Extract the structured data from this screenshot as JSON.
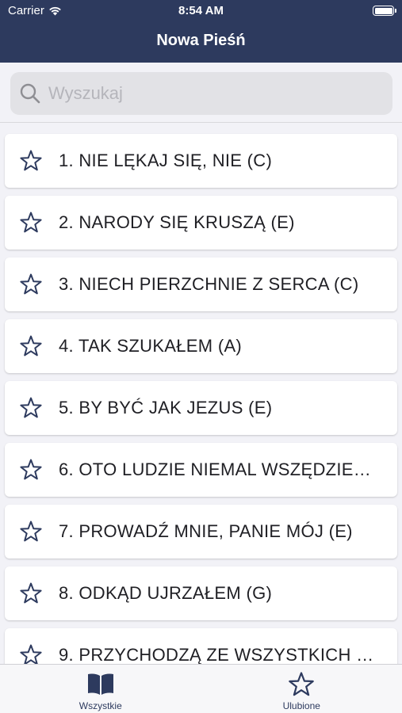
{
  "status_bar": {
    "carrier": "Carrier",
    "time": "8:54 AM"
  },
  "nav": {
    "title": "Nowa Pieśń"
  },
  "search": {
    "placeholder": "Wyszukaj"
  },
  "songs": [
    {
      "title": "1. NIE LĘKAJ SIĘ, NIE (C)"
    },
    {
      "title": "2. NARODY SIĘ KRUSZĄ (E)"
    },
    {
      "title": "3. NIECH PIERZCHNIE Z SERCA (C)"
    },
    {
      "title": "4. TAK SZUKAŁEM (A)"
    },
    {
      "title": "5. BY BYĆ JAK JEZUS (E)"
    },
    {
      "title": "6. OTO LUDZIE NIEMAL WSZĘDZIE…"
    },
    {
      "title": "7. PROWADŹ MNIE, PANIE MÓJ (E)"
    },
    {
      "title": "8. ODKĄD UJRZAŁEM (G)"
    },
    {
      "title": "9. PRZYCHODZĄ ZE WSZYSTKICH …"
    }
  ],
  "tabs": [
    {
      "label": "Wszystkie",
      "icon": "book-icon"
    },
    {
      "label": "Ulubione",
      "icon": "star-icon"
    }
  ],
  "colors": {
    "primary": "#2d3a5e",
    "background": "#f2f2f7",
    "card": "#ffffff"
  }
}
